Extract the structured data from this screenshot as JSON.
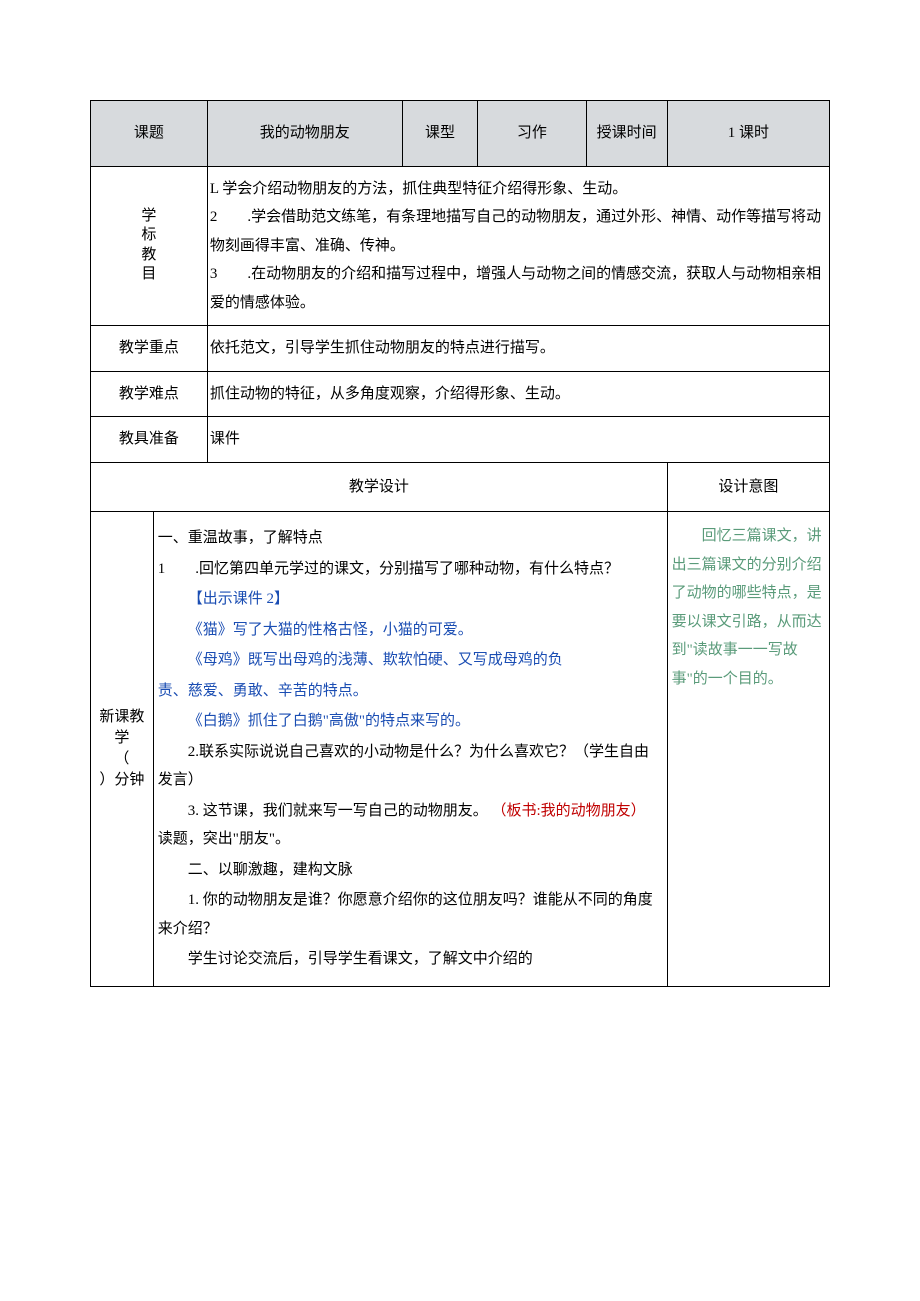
{
  "header": {
    "col1_label": "课题",
    "col1_value": "我的动物朋友",
    "col2_label": "课型",
    "col2_value": "习作",
    "col3_label": "授课时间",
    "col3_value": "1 课时"
  },
  "objectives": {
    "label": "学标\n教目",
    "line1": "L 学会介绍动物朋友的方法，抓住典型特征介绍得形象、生动。",
    "line2": "2　　.学会借助范文练笔，有条理地描写自己的动物朋友，通过外形、神情、动作等描写将动物刻画得丰富、准确、传神。",
    "line3": "3　　.在动物朋友的介绍和描写过程中，增强人与动物之间的情感交流，获取人与动物相亲相爱的情感体验。"
  },
  "keypoint": {
    "label": "教学重点",
    "text": "依托范文，引导学生抓住动物朋友的特点进行描写。"
  },
  "difficulty": {
    "label": "教学难点",
    "text": "抓住动物的特征，从多角度观察，介绍得形象、生动。"
  },
  "prep": {
    "label": "教具准备",
    "text": "课件"
  },
  "design_header": {
    "left": "教学设计",
    "right": "设计意图"
  },
  "left_col_label": "新课教学\n（\n）分钟",
  "main": {
    "sec1_title": "一、重温故事，了解特点",
    "p1": "1　　.回忆第四单元学过的课文，分别描写了哪种动物，有什么特点？",
    "slide": "【出示课件 2】",
    "p2": "《猫》写了大猫的性格古怪，小猫的可爱。",
    "p3a": "《母鸡》既写出母鸡的浅薄、欺软怕硬、又写成母鸡的负",
    "p3b": "责、慈爱、勇敢、辛苦的特点。",
    "p4": "《白鹅》抓住了白鹅\"高傲\"的特点来写的。",
    "p5": "2.联系实际说说自己喜欢的小动物是什么？为什么喜欢它？（学生自由发言）",
    "p6a": "3. 这节课，我们就来写一写自己的动物朋友。",
    "p6b": "（板书:我的动物朋友）",
    "p6c": "读题，突出\"朋友\"。",
    "sec2_title": "二、以聊激趣，建构文脉",
    "p7": "1. 你的动物朋友是谁？你愿意介绍你的这位朋友吗？谁能从不同的角度来介绍？",
    "p8": "学生讨论交流后，引导学生看课文，了解文中介绍的"
  },
  "intent": {
    "p1": "回忆三篇课文，讲出三篇课文的分别介绍了动物的哪些特点，是要以课文引路，从而达到\"读故事一一写故事\"的一个目的。"
  }
}
